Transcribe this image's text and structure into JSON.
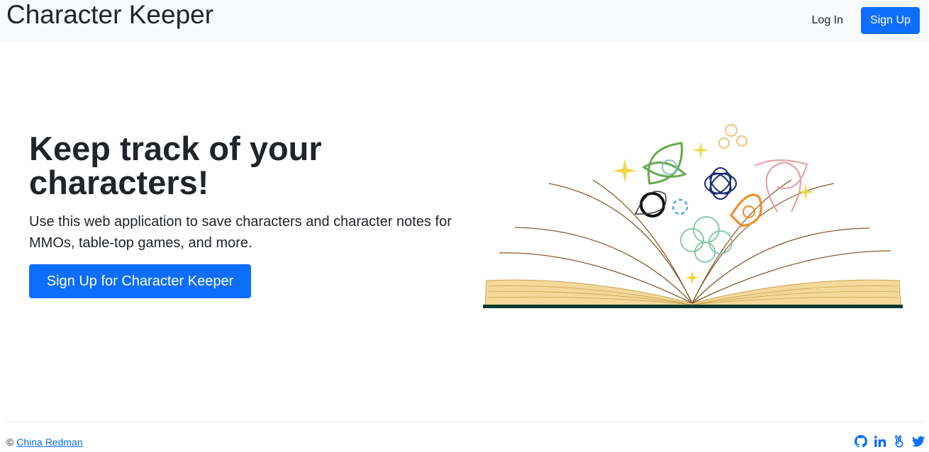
{
  "navbar": {
    "brand": "Character Keeper",
    "login_label": "Log In",
    "signup_label": "Sign Up"
  },
  "hero": {
    "title": "Keep track of your characters!",
    "lead": "Use this web application to save characters and character notes for MMOs, table-top games, and more.",
    "cta_label": "Sign Up for Character Keeper"
  },
  "footer": {
    "copyright_symbol": "©",
    "author": "China Redman",
    "icons": [
      "github-icon",
      "linkedin-icon",
      "angellist-icon",
      "twitter-icon"
    ]
  },
  "colors": {
    "primary": "#0d6efd",
    "navbar_bg": "#f8f9fa",
    "text": "#212529"
  }
}
